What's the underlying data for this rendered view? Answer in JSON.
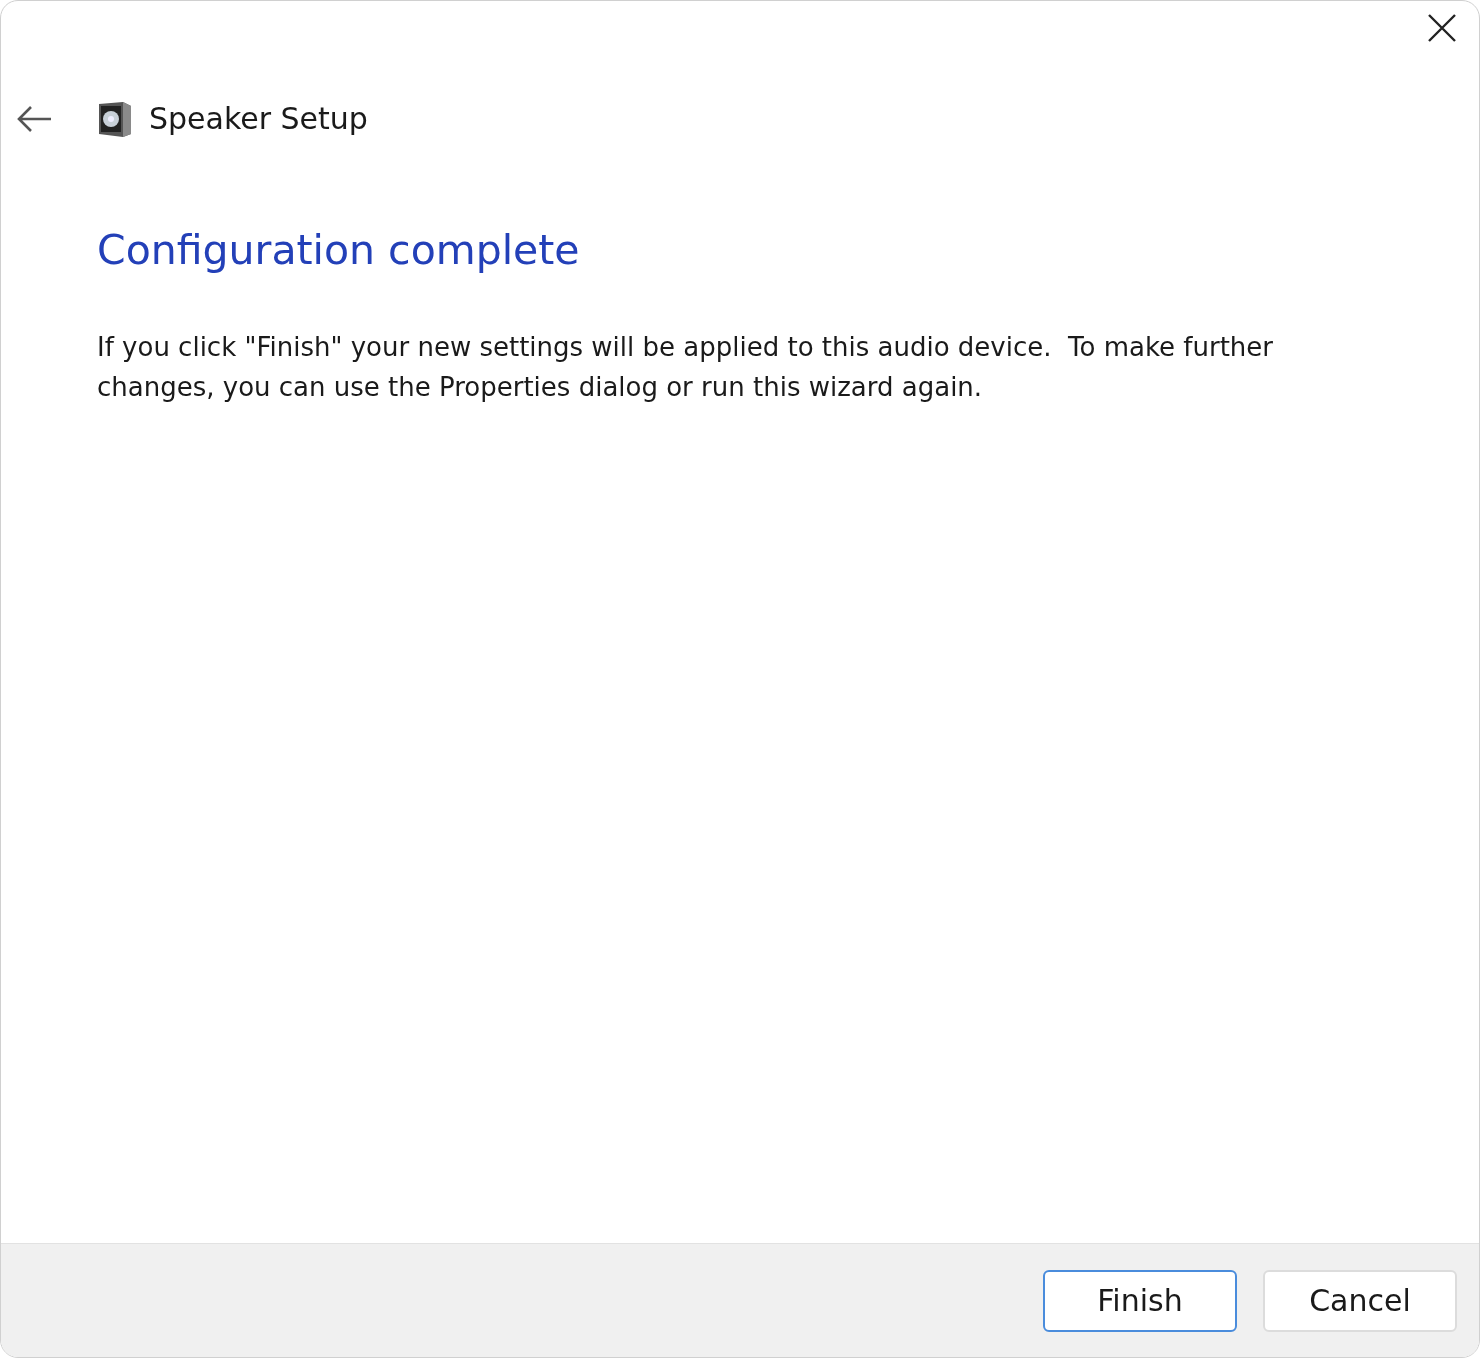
{
  "window": {
    "title": "Speaker Setup"
  },
  "heading": "Configuration complete",
  "message": "If you click \"Finish\" your new settings will be applied to this audio device.  To make further changes, you can use the Properties dialog or run this wizard again.",
  "buttons": [
    {
      "label": "Finish",
      "default": true
    },
    {
      "label": "Cancel",
      "default": false
    }
  ]
}
